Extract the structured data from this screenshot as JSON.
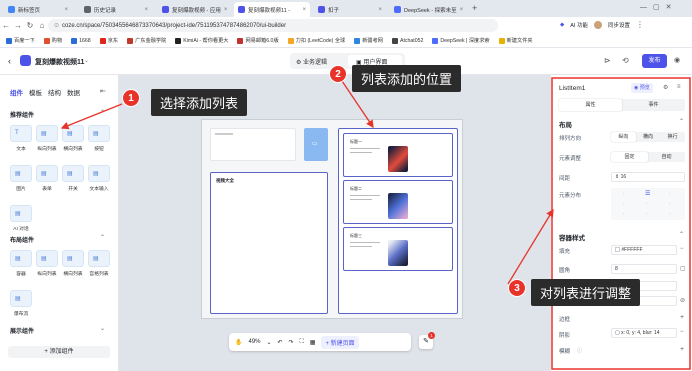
{
  "tabs": [
    {
      "label": "新标签页",
      "color": "#4285f4"
    },
    {
      "label": "历史记录",
      "color": "#5f6368"
    },
    {
      "label": "复刻爆款视频 - 应用",
      "color": "#4d53e8"
    },
    {
      "label": "复刻爆款视频11 -",
      "color": "#4d53e8"
    },
    {
      "label": "扣子",
      "color": "#4d53e8"
    },
    {
      "label": "DeepSeek - 探索未至",
      "color": "#4d6bfe"
    }
  ],
  "address": {
    "url": "coze.cn/space/7503455646873370643/project-ide/7511953747874862070/ui-builder",
    "right_items": [
      "AI 功能",
      "同步设置"
    ]
  },
  "bookmarks": [
    "百度一下",
    "购物",
    "1668",
    "京东",
    "广东金融学院",
    "KimiAi - 帮你看更大",
    "网易邮箱6.0版",
    "力扣 (LeetCode) 全球",
    "新疆考网",
    "Atchat052",
    "DeepSeek | 深度求索",
    "新建文件夹"
  ],
  "header": {
    "project_title": "复刻爆款视频11",
    "center_tabs": [
      "业务逻辑",
      "用户界面"
    ],
    "publish_label": "发布"
  },
  "left_panel": {
    "tabs": [
      "组件",
      "模板",
      "结构",
      "数据"
    ],
    "section_recommended": "推荐组件",
    "recommended": [
      "文本",
      "纵向列表",
      "横向列表",
      "按钮",
      "图片",
      "表单",
      "开关",
      "文本输入",
      "AI 对话"
    ],
    "section_layout": "布局组件",
    "layout": [
      "容器",
      "纵向列表",
      "横向列表",
      "宫格列表",
      "瀑布流"
    ],
    "section_display": "展示组件",
    "add_component_label": "添加组件"
  },
  "canvas": {
    "page_title": "页面",
    "left_box_text": "视频大全",
    "list_items": [
      {
        "title": "标题一",
        "desc": "描述"
      },
      {
        "title": "标题二",
        "desc": "描述"
      },
      {
        "title": "标题三",
        "desc": "描述"
      }
    ],
    "zoom": "49%",
    "new_page_label": "新建页面",
    "notification_count": "1"
  },
  "right_panel": {
    "component_name": "ListItem1",
    "preview_tag": "预览",
    "tabs": [
      "属性",
      "事件"
    ],
    "section_layout": "布局",
    "arrange_label": "排列方向",
    "arrange_options": [
      "纵向",
      "横向",
      "换行"
    ],
    "size_label": "元素调整",
    "size_options": [
      "固定",
      "自动"
    ],
    "gap_label": "间距",
    "gap_value": "16",
    "align_label": "元素分布",
    "section_style": "容器样式",
    "fill_label": "填充",
    "fill_value": "#FFFFFF",
    "radius_label": "圆角",
    "radius_value": "8",
    "border_label": "边框",
    "shadow_label": "阴影",
    "shadow_value": "x: 0, y: 4, blur: 14",
    "blur_label": "模糊"
  },
  "annotations": [
    {
      "num": "1",
      "text": "选择添加列表"
    },
    {
      "num": "2",
      "text": "列表添加的位置"
    },
    {
      "num": "3",
      "text": "对列表进行调整"
    }
  ],
  "colors": {
    "accent": "#4d53e8",
    "badge": "#e8332a",
    "callout_bg": "#2b2b2b",
    "arrow": "#e8332a"
  }
}
